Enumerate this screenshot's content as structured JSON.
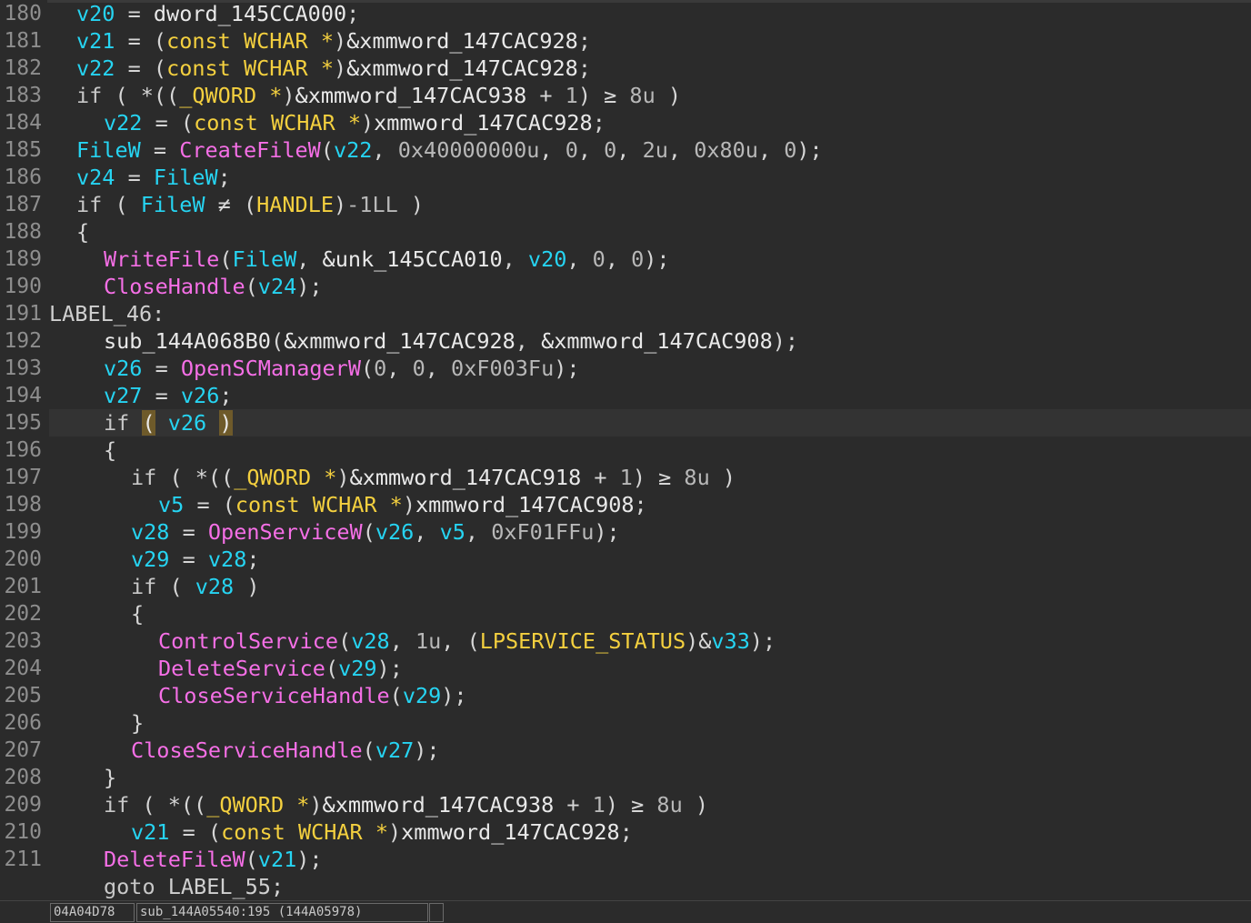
{
  "editor": {
    "current_line": 195,
    "lines": [
      {
        "n": "180",
        "indent": 1,
        "tokens": [
          [
            "var",
            "v20"
          ],
          [
            "op",
            " = "
          ],
          [
            "glob",
            "dword_145CCA000"
          ],
          [
            "punc",
            ";"
          ]
        ]
      },
      {
        "n": "181",
        "indent": 1,
        "tokens": [
          [
            "var",
            "v21"
          ],
          [
            "op",
            " = "
          ],
          [
            "punc",
            "("
          ],
          [
            "type",
            "const WCHAR *"
          ],
          [
            "punc",
            ")"
          ],
          [
            "glob",
            "&xmmword_147CAC928"
          ],
          [
            "punc",
            ";"
          ]
        ]
      },
      {
        "n": "182",
        "indent": 1,
        "tokens": [
          [
            "var",
            "v22"
          ],
          [
            "op",
            " = "
          ],
          [
            "punc",
            "("
          ],
          [
            "type",
            "const WCHAR *"
          ],
          [
            "punc",
            ")"
          ],
          [
            "glob",
            "&xmmword_147CAC928"
          ],
          [
            "punc",
            ";"
          ]
        ]
      },
      {
        "n": "183",
        "indent": 1,
        "tokens": [
          [
            "kw",
            "if"
          ],
          [
            "punc",
            " ( "
          ],
          [
            "op",
            "*(("
          ],
          [
            "type",
            "_QWORD *"
          ],
          [
            "punc",
            ")"
          ],
          [
            "glob",
            "&xmmword_147CAC938"
          ],
          [
            "op",
            " + "
          ],
          [
            "num",
            "1"
          ],
          [
            "punc",
            ") "
          ],
          [
            "op",
            "≥ "
          ],
          [
            "num",
            "8u"
          ],
          [
            "punc",
            " )"
          ]
        ]
      },
      {
        "n": "184",
        "indent": 2,
        "tokens": [
          [
            "var",
            "v22"
          ],
          [
            "op",
            " = "
          ],
          [
            "punc",
            "("
          ],
          [
            "type",
            "const WCHAR *"
          ],
          [
            "punc",
            ")"
          ],
          [
            "glob",
            "xmmword_147CAC928"
          ],
          [
            "punc",
            ";"
          ]
        ]
      },
      {
        "n": "185",
        "indent": 1,
        "tokens": [
          [
            "var",
            "FileW"
          ],
          [
            "op",
            " = "
          ],
          [
            "fn",
            "CreateFileW"
          ],
          [
            "punc",
            "("
          ],
          [
            "var",
            "v22"
          ],
          [
            "punc",
            ", "
          ],
          [
            "num",
            "0x40000000u"
          ],
          [
            "punc",
            ", "
          ],
          [
            "num",
            "0"
          ],
          [
            "punc",
            ", "
          ],
          [
            "num",
            "0"
          ],
          [
            "punc",
            ", "
          ],
          [
            "num",
            "2u"
          ],
          [
            "punc",
            ", "
          ],
          [
            "num",
            "0x80u"
          ],
          [
            "punc",
            ", "
          ],
          [
            "num",
            "0"
          ],
          [
            "punc",
            ");"
          ]
        ]
      },
      {
        "n": "186",
        "indent": 1,
        "tokens": [
          [
            "var",
            "v24"
          ],
          [
            "op",
            " = "
          ],
          [
            "var",
            "FileW"
          ],
          [
            "punc",
            ";"
          ]
        ]
      },
      {
        "n": "187",
        "indent": 1,
        "tokens": [
          [
            "kw",
            "if"
          ],
          [
            "punc",
            " ( "
          ],
          [
            "var",
            "FileW"
          ],
          [
            "op",
            " ≠ "
          ],
          [
            "punc",
            "("
          ],
          [
            "type",
            "HANDLE"
          ],
          [
            "punc",
            ")"
          ],
          [
            "num",
            "-1LL"
          ],
          [
            "punc",
            " )"
          ]
        ]
      },
      {
        "n": "188",
        "indent": 1,
        "tokens": [
          [
            "brace",
            "{"
          ]
        ]
      },
      {
        "n": "189",
        "indent": 2,
        "tokens": [
          [
            "fn",
            "WriteFile"
          ],
          [
            "punc",
            "("
          ],
          [
            "var",
            "FileW"
          ],
          [
            "punc",
            ", "
          ],
          [
            "glob",
            "&unk_145CCA010"
          ],
          [
            "punc",
            ", "
          ],
          [
            "var",
            "v20"
          ],
          [
            "punc",
            ", "
          ],
          [
            "num",
            "0"
          ],
          [
            "punc",
            ", "
          ],
          [
            "num",
            "0"
          ],
          [
            "punc",
            ");"
          ]
        ]
      },
      {
        "n": "190",
        "indent": 2,
        "tokens": [
          [
            "fn",
            "CloseHandle"
          ],
          [
            "punc",
            "("
          ],
          [
            "var",
            "v24"
          ],
          [
            "punc",
            ");"
          ]
        ]
      },
      {
        "n": "191",
        "indent": 0,
        "tokens": [
          [
            "lbl",
            "LABEL_46:"
          ]
        ]
      },
      {
        "n": "192",
        "indent": 2,
        "tokens": [
          [
            "glob",
            "sub_144A068B0"
          ],
          [
            "punc",
            "("
          ],
          [
            "glob",
            "&xmmword_147CAC928"
          ],
          [
            "punc",
            ", "
          ],
          [
            "glob",
            "&xmmword_147CAC908"
          ],
          [
            "punc",
            ");"
          ]
        ]
      },
      {
        "n": "193",
        "indent": 2,
        "tokens": [
          [
            "var",
            "v26"
          ],
          [
            "op",
            " = "
          ],
          [
            "fn",
            "OpenSCManagerW"
          ],
          [
            "punc",
            "("
          ],
          [
            "num",
            "0"
          ],
          [
            "punc",
            ", "
          ],
          [
            "num",
            "0"
          ],
          [
            "punc",
            ", "
          ],
          [
            "num",
            "0xF003Fu"
          ],
          [
            "punc",
            ");"
          ]
        ]
      },
      {
        "n": "194",
        "indent": 2,
        "tokens": [
          [
            "var",
            "v27"
          ],
          [
            "op",
            " = "
          ],
          [
            "var",
            "v26"
          ],
          [
            "punc",
            ";"
          ]
        ]
      },
      {
        "n": "195",
        "indent": 2,
        "tokens": [
          [
            "kw",
            "if"
          ],
          [
            "punc",
            " "
          ],
          [
            "hl",
            "("
          ],
          [
            "punc",
            " "
          ],
          [
            "var",
            "v26"
          ],
          [
            "punc",
            " "
          ],
          [
            "hl",
            ")"
          ]
        ]
      },
      {
        "n": "196",
        "indent": 2,
        "tokens": [
          [
            "brace",
            "{"
          ]
        ]
      },
      {
        "n": "197",
        "indent": 3,
        "tokens": [
          [
            "kw",
            "if"
          ],
          [
            "punc",
            " ( "
          ],
          [
            "op",
            "*(("
          ],
          [
            "type",
            "_QWORD *"
          ],
          [
            "punc",
            ")"
          ],
          [
            "glob",
            "&xmmword_147CAC918"
          ],
          [
            "op",
            " + "
          ],
          [
            "num",
            "1"
          ],
          [
            "punc",
            ") "
          ],
          [
            "op",
            "≥ "
          ],
          [
            "num",
            "8u"
          ],
          [
            "punc",
            " )"
          ]
        ]
      },
      {
        "n": "198",
        "indent": 4,
        "tokens": [
          [
            "var",
            "v5"
          ],
          [
            "op",
            " = "
          ],
          [
            "punc",
            "("
          ],
          [
            "type",
            "const WCHAR *"
          ],
          [
            "punc",
            ")"
          ],
          [
            "glob",
            "xmmword_147CAC908"
          ],
          [
            "punc",
            ";"
          ]
        ]
      },
      {
        "n": "199",
        "indent": 3,
        "tokens": [
          [
            "var",
            "v28"
          ],
          [
            "op",
            " = "
          ],
          [
            "fn",
            "OpenServiceW"
          ],
          [
            "punc",
            "("
          ],
          [
            "var",
            "v26"
          ],
          [
            "punc",
            ", "
          ],
          [
            "var",
            "v5"
          ],
          [
            "punc",
            ", "
          ],
          [
            "num",
            "0xF01FFu"
          ],
          [
            "punc",
            ");"
          ]
        ]
      },
      {
        "n": "200",
        "indent": 3,
        "tokens": [
          [
            "var",
            "v29"
          ],
          [
            "op",
            " = "
          ],
          [
            "var",
            "v28"
          ],
          [
            "punc",
            ";"
          ]
        ]
      },
      {
        "n": "201",
        "indent": 3,
        "tokens": [
          [
            "kw",
            "if"
          ],
          [
            "punc",
            " ( "
          ],
          [
            "var",
            "v28"
          ],
          [
            "punc",
            " )"
          ]
        ]
      },
      {
        "n": "202",
        "indent": 3,
        "tokens": [
          [
            "brace",
            "{"
          ]
        ]
      },
      {
        "n": "203",
        "indent": 4,
        "tokens": [
          [
            "fn",
            "ControlService"
          ],
          [
            "punc",
            "("
          ],
          [
            "var",
            "v28"
          ],
          [
            "punc",
            ", "
          ],
          [
            "num",
            "1u"
          ],
          [
            "punc",
            ", ("
          ],
          [
            "type",
            "LPSERVICE_STATUS"
          ],
          [
            "punc",
            ")&"
          ],
          [
            "var",
            "v33"
          ],
          [
            "punc",
            ");"
          ]
        ]
      },
      {
        "n": "204",
        "indent": 4,
        "tokens": [
          [
            "fn",
            "DeleteService"
          ],
          [
            "punc",
            "("
          ],
          [
            "var",
            "v29"
          ],
          [
            "punc",
            ");"
          ]
        ]
      },
      {
        "n": "205",
        "indent": 4,
        "tokens": [
          [
            "fn",
            "CloseServiceHandle"
          ],
          [
            "punc",
            "("
          ],
          [
            "var",
            "v29"
          ],
          [
            "punc",
            ");"
          ]
        ]
      },
      {
        "n": "206",
        "indent": 3,
        "tokens": [
          [
            "brace",
            "}"
          ]
        ]
      },
      {
        "n": "207",
        "indent": 3,
        "tokens": [
          [
            "fn",
            "CloseServiceHandle"
          ],
          [
            "punc",
            "("
          ],
          [
            "var",
            "v27"
          ],
          [
            "punc",
            ");"
          ]
        ]
      },
      {
        "n": "208",
        "indent": 2,
        "tokens": [
          [
            "brace",
            "}"
          ]
        ]
      },
      {
        "n": "209",
        "indent": 2,
        "tokens": [
          [
            "kw",
            "if"
          ],
          [
            "punc",
            " ( "
          ],
          [
            "op",
            "*(("
          ],
          [
            "type",
            "_QWORD *"
          ],
          [
            "punc",
            ")"
          ],
          [
            "glob",
            "&xmmword_147CAC938"
          ],
          [
            "op",
            " + "
          ],
          [
            "num",
            "1"
          ],
          [
            "punc",
            ") "
          ],
          [
            "op",
            "≥ "
          ],
          [
            "num",
            "8u"
          ],
          [
            "punc",
            " )"
          ]
        ]
      },
      {
        "n": "210",
        "indent": 3,
        "tokens": [
          [
            "var",
            "v21"
          ],
          [
            "op",
            " = "
          ],
          [
            "punc",
            "("
          ],
          [
            "type",
            "const WCHAR *"
          ],
          [
            "punc",
            ")"
          ],
          [
            "glob",
            "xmmword_147CAC928"
          ],
          [
            "punc",
            ";"
          ]
        ]
      },
      {
        "n": "211",
        "indent": 2,
        "tokens": [
          [
            "fn",
            "DeleteFileW"
          ],
          [
            "punc",
            "("
          ],
          [
            "var",
            "v21"
          ],
          [
            "punc",
            ");"
          ]
        ]
      },
      {
        "n": "",
        "indent": 2,
        "tokens": [
          [
            "kw",
            "goto "
          ],
          [
            "lbl",
            "LABEL_55"
          ],
          [
            "punc",
            ";"
          ]
        ]
      }
    ]
  },
  "statusbar": {
    "address": "04A04D78",
    "location": "sub_144A05540:195 (144A05978)",
    "extra": ""
  },
  "colors": {
    "background": "#2b2b2b",
    "variable": "#26d4f2",
    "function": "#f56fe6",
    "type": "#f4d03f",
    "current_line": "#333333",
    "paren_highlight": "#6e5a2a"
  }
}
